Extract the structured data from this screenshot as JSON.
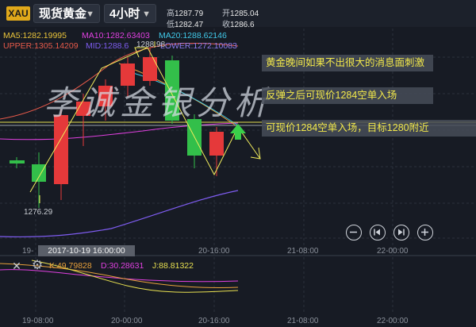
{
  "header": {
    "symbol_badge": "XAU",
    "instrument": "现货黄金",
    "timeframe": "4小时",
    "quotes": {
      "high_label": "高",
      "high": "1287.79",
      "open_label": "开",
      "open": "1285.04",
      "low_label": "低",
      "low": "1282.47",
      "close_label": "收",
      "close": "1286.6"
    }
  },
  "indicators": {
    "ma5": "MA5:1282.19995",
    "ma10": "MA10:1282.63403",
    "ma20": "MA20:1288.62146",
    "upper": "UPPER:1305.14209",
    "mid": "MID:1288.6",
    "lower": "LOWER:1272.10083",
    "colors": {
      "ma5": "#e8c33a",
      "ma10": "#e040e0",
      "ma20": "#40c8e8",
      "upper": "#e85a4a",
      "mid": "#7e5cf0",
      "lower": "#8f7cf0"
    }
  },
  "price_markers": {
    "high": "1288.98",
    "low": "1276.29"
  },
  "annotations": [
    "黄金晚间如果不出很大的消息面刺激",
    "反弹之后可现价1284空单入场",
    "可现价1284空单入场，目标1280附近"
  ],
  "watermark": "李诚金银分析",
  "controls": [
    "zoom-out-icon",
    "rewind-icon",
    "forward-icon",
    "zoom-in-icon"
  ],
  "tooltip_time": "2017-10-19 16:00:00",
  "x_axis_main": [
    "20-16:00",
    "21-08:00",
    "22-00:00"
  ],
  "x_axis_sub": [
    "19-08:00",
    "20-00:00",
    "20-16:00",
    "21-08:00",
    "22-00:00"
  ],
  "x_axis_left_partial": "19-",
  "kdj": {
    "k": "K:49.79828",
    "d": "D:30.28631",
    "j": "J:88.81322",
    "colors": {
      "k": "#e8a03a",
      "d": "#e040e0",
      "j": "#e8e050"
    }
  },
  "colors": {
    "up": "#e5393a",
    "down": "#33bf4a",
    "background": "#171b24"
  }
}
